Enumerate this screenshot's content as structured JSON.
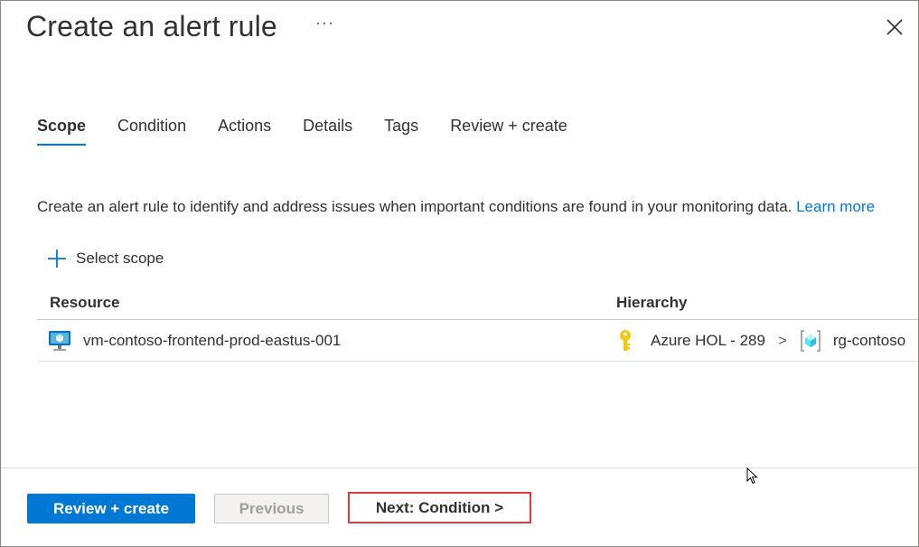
{
  "header": {
    "title": "Create an alert rule",
    "more_label": "···"
  },
  "tabs": [
    {
      "label": "Scope",
      "active": true
    },
    {
      "label": "Condition",
      "active": false
    },
    {
      "label": "Actions",
      "active": false
    },
    {
      "label": "Details",
      "active": false
    },
    {
      "label": "Tags",
      "active": false
    },
    {
      "label": "Review + create",
      "active": false
    }
  ],
  "description": {
    "text": "Create an alert rule to identify and address issues when important conditions are found in your monitoring data. ",
    "link_text": "Learn more"
  },
  "select_scope": {
    "label": "Select scope",
    "icon": "plus-icon"
  },
  "table": {
    "headers": [
      "Resource",
      "Hierarchy"
    ],
    "rows": [
      {
        "resource": "vm-contoso-frontend-prod-eastus-001",
        "resource_icon": "virtual-machine-icon",
        "subscription": "Azure HOL - 289",
        "subscription_icon": "key-icon",
        "separator": ">",
        "resource_group": "rg-contoso",
        "resource_group_icon": "resource-group-icon"
      }
    ]
  },
  "footer": {
    "review_create_label": "Review + create",
    "previous_label": "Previous",
    "next_label": "Next: Condition >"
  },
  "colors": {
    "accent": "#0078d4",
    "highlight_border": "#e5393f",
    "key_icon": "#f2c811"
  }
}
